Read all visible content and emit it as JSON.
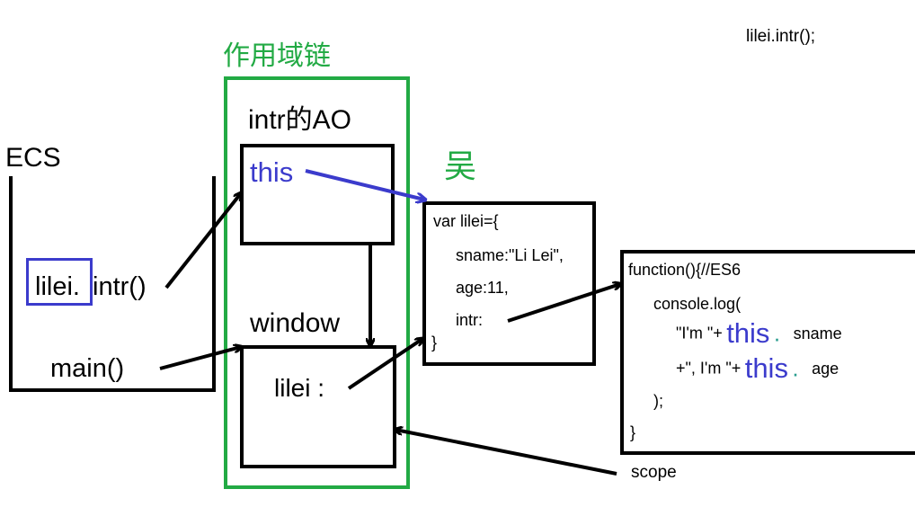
{
  "top_call": "lilei.intr();",
  "scope_chain": {
    "title": "作用域链",
    "color": "#22aa44"
  },
  "ecs": {
    "label": "ECS",
    "frame_intr": "intr()",
    "frame_intr_highlight": "lilei.",
    "frame_main": "main()"
  },
  "ao": {
    "title": "intr的AO",
    "this_label": "this"
  },
  "window": {
    "title": "window",
    "var": "lilei :"
  },
  "annotation_char": "吴",
  "object_code": {
    "line1": "var lilei={",
    "line2": "sname:\"Li Lei\",",
    "line3": "age:11,",
    "line4": "intr:",
    "line5": "}"
  },
  "function_code": {
    "line1": "function(){//ES6",
    "line2": "console.log(",
    "line3_pre": "\"I'm \"+",
    "line3_this": "this",
    "line3_dot": ".",
    "line3_post": "sname",
    "line4_pre": "+\", I'm \"+",
    "line4_this": "this",
    "line4_dot": ".",
    "line4_post": "age",
    "line5": ");",
    "line6": "}"
  },
  "scope_label": "scope",
  "colors": {
    "accent_blue": "#3b3bcc",
    "green": "#22aa44",
    "teal": "#2a9d8f"
  }
}
